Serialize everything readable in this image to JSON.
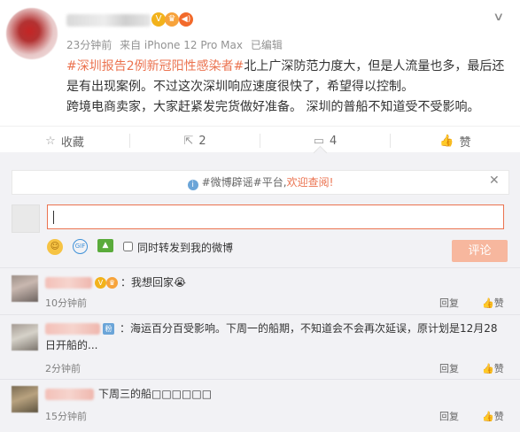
{
  "post": {
    "time": "23分钟前",
    "source": "来自 iPhone 12 Pro Max",
    "edited": "已编辑",
    "topic": "#深圳报告2例新冠阳性感染者#",
    "text_after_topic": "北上广深防范力度大，但是人流量也多，最后还是有出现案例。不过这次深圳响应速度很快了，希望得以控制。",
    "text_line2": "跨境电商卖家，大家赶紧发完货做好准备。 深圳的普船不知道受不受影响。"
  },
  "actions": {
    "favorite_label": "收藏",
    "repost_count": "2",
    "comment_count": "4",
    "like_label": "赞"
  },
  "notice": {
    "prefix": "#微博辟谣#平台,",
    "accent": "欢迎查阅!"
  },
  "composer": {
    "input_value": "",
    "repost_label": "同时转发到我的微博",
    "submit_label": "评论",
    "gif_label": "GIF"
  },
  "comments": [
    {
      "text": "：我想回家😭",
      "time": "10分钟前",
      "reply": "回复",
      "like": "赞"
    },
    {
      "text": "：海运百分百受影响。下周一的船期，不知道会不会再次延误，原计划是12月28日开船的...",
      "time": "2分钟前",
      "reply": "回复",
      "like": "赞"
    },
    {
      "text": "下周三的船□□□□□□",
      "time": "15分钟前",
      "reply": "回复",
      "like": "赞"
    }
  ],
  "colors": {
    "accent": "#eb7350",
    "panel_bg": "#f2f2f5",
    "button_disabled": "#f7b79e"
  },
  "icons": [
    "chevron-down-icon",
    "verified-icon",
    "crown-icon",
    "speaker-icon",
    "star-icon",
    "repost-icon",
    "comment-icon",
    "like-icon",
    "info-icon",
    "close-icon",
    "emoji-icon",
    "gif-icon",
    "image-icon"
  ]
}
